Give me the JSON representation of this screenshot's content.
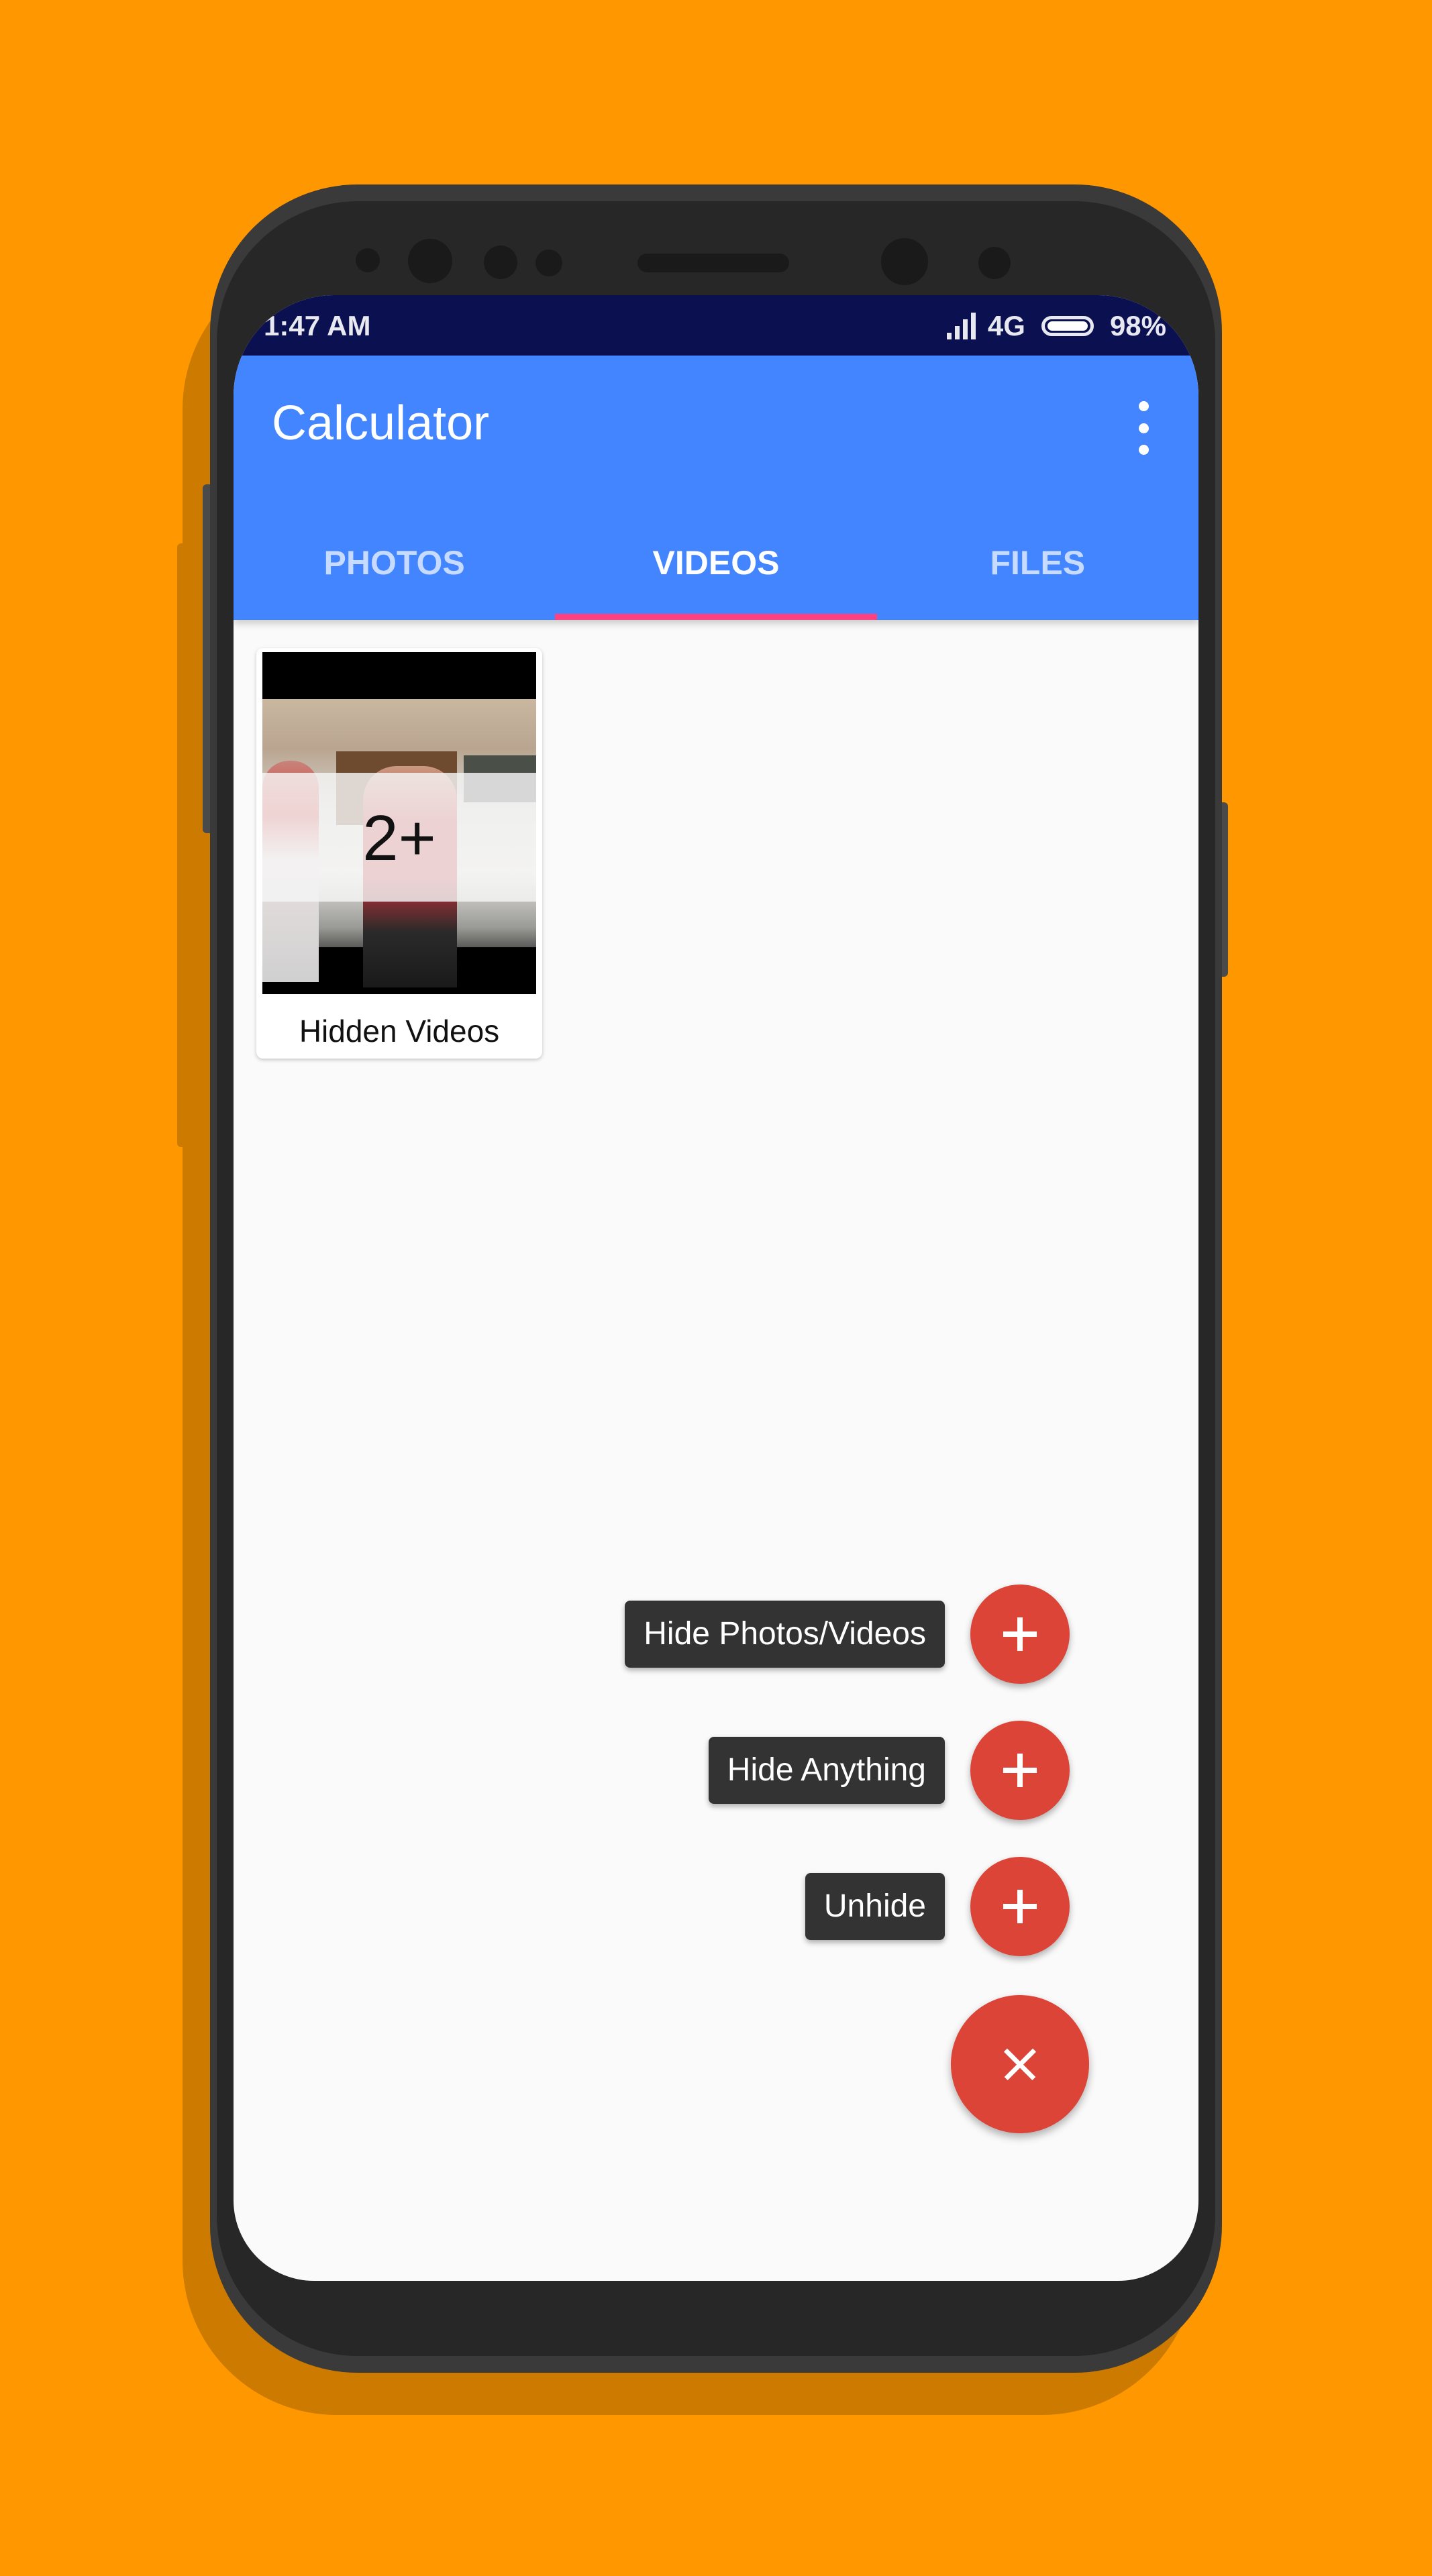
{
  "status_bar": {
    "time": "1:47 AM",
    "network": "4G",
    "battery": "98%",
    "icons": [
      "signal-icon",
      "battery-icon"
    ]
  },
  "app_bar": {
    "title": "Calculator",
    "menu_icon": "more-vert-icon"
  },
  "tabs": [
    {
      "label": "PHOTOS",
      "active": false
    },
    {
      "label": "VIDEOS",
      "active": true
    },
    {
      "label": "FILES",
      "active": false
    }
  ],
  "folders": [
    {
      "label": "Hidden Videos",
      "count": "2+"
    }
  ],
  "fab_menu": {
    "items": [
      {
        "label": "Hide Photos/Videos",
        "icon": "plus-icon"
      },
      {
        "label": "Hide Anything",
        "icon": "plus-icon"
      },
      {
        "label": "Unhide",
        "icon": "plus-icon"
      }
    ],
    "main_icon": "close-icon"
  },
  "colors": {
    "background": "#FF9800",
    "status_bar": "#0B1150",
    "app_bar": "#4285FF",
    "tab_indicator": "#FF4081",
    "fab": "#DB4437",
    "fab_label": "#333333"
  }
}
